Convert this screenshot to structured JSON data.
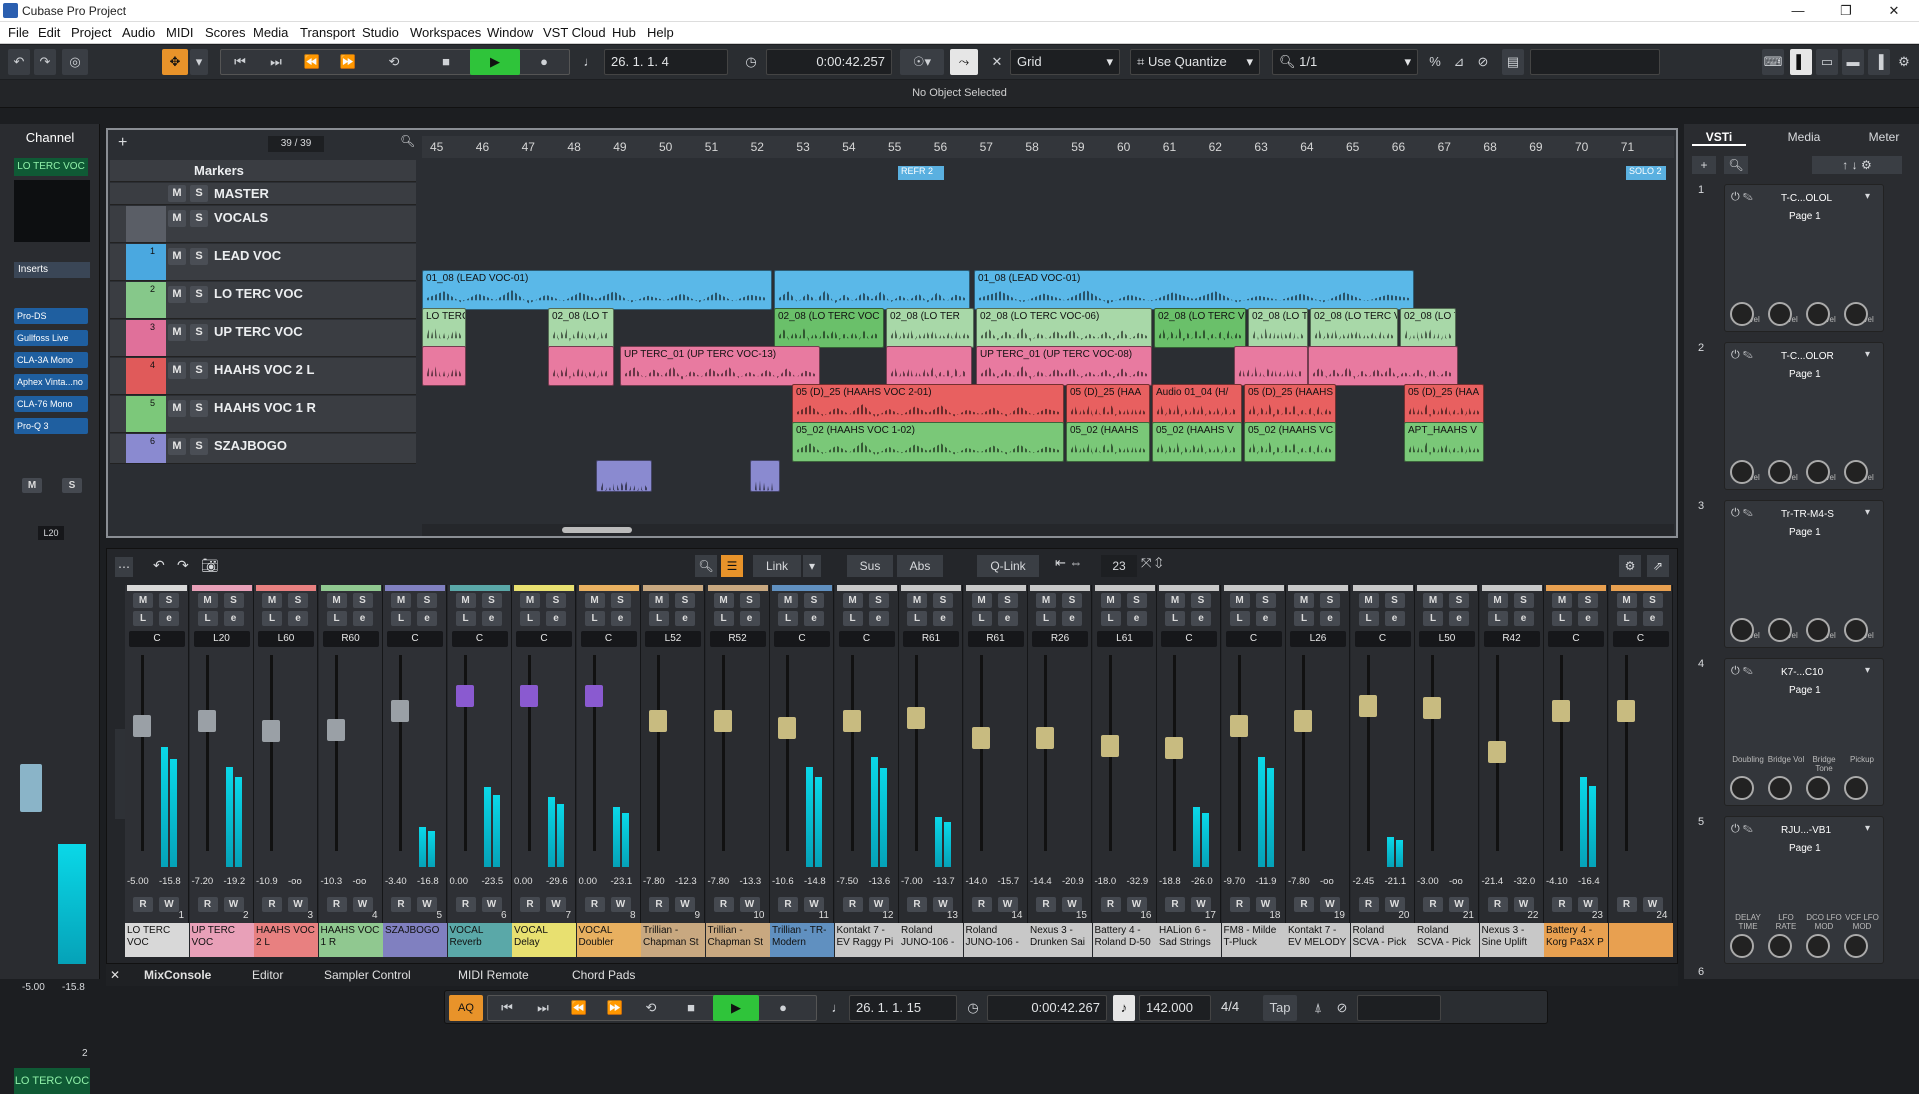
{
  "window": {
    "title": "Cubase Pro Project",
    "min": "—",
    "max": "❐",
    "close": "✕"
  },
  "menu": [
    "File",
    "Edit",
    "Project",
    "Audio",
    "MIDI",
    "Scores",
    "Media",
    "Transport",
    "Studio",
    "Workspaces",
    "Window",
    "VST Cloud",
    "Hub",
    "Help"
  ],
  "toolbar": {
    "position": "26. 1. 1.  4",
    "time": "0:00:42.257",
    "grid": "Grid",
    "quantize": "Use Quantize",
    "quant_value": "1/1"
  },
  "infoline": "No Object Selected",
  "left": {
    "title": "Channel",
    "track": "LO TERC VOC",
    "inserts_label": "Inserts",
    "inserts": [
      "Pro-DS",
      "Gullfoss Live",
      "CLA-3A Mono",
      "Aphex Vinta...no",
      "CLA-76 Mono",
      "Pro-Q 3"
    ],
    "pan": "L20",
    "vol_a": "-5.00",
    "vol_b": "-15.8",
    "bottom_name": "LO TERC VOC",
    "num": "2"
  },
  "project": {
    "count": "39 / 39",
    "bars": [
      "45",
      "46",
      "47",
      "48",
      "49",
      "50",
      "51",
      "52",
      "53",
      "54",
      "55",
      "56",
      "57",
      "58",
      "59",
      "60",
      "61",
      "62",
      "63",
      "64",
      "65",
      "66",
      "67",
      "68",
      "69",
      "70",
      "71"
    ],
    "markers_label": "Markers",
    "master_label": "MASTER",
    "marker_refr": "REFR 2",
    "marker_solo": "SOLO 2",
    "tracks": [
      {
        "name": "VOCALS",
        "num": ""
      },
      {
        "name": "LEAD VOC",
        "num": "1"
      },
      {
        "name": "LO TERC VOC",
        "num": "2"
      },
      {
        "name": "UP TERC VOC",
        "num": "3"
      },
      {
        "name": "HAAHS VOC 2 L",
        "num": "4"
      },
      {
        "name": "HAAHS VOC 1 R",
        "num": "5"
      },
      {
        "name": "SZAJBOGO",
        "num": "6"
      }
    ],
    "clips": {
      "lead1": "01_08 (LEAD VOC-01)",
      "lead2": "01_08 (LEAD VOC-01)",
      "lo1": "LO TERC",
      "lo2": "02_08 (LO T",
      "lo3": "02_08 (LO TERC VOC",
      "lo4": "02_08 (LO TER",
      "lo5": "02_08 (LO TERC VOC-06)",
      "lo6": "02_08 (LO TERC V",
      "lo7": "02_08 (LO TER",
      "lo8": "02_08 (LO TERC VC",
      "lo9": "02_08 (LO TERC",
      "up1": "UP TERC_01 (UP TERC VOC-13)",
      "up2": "UP TERC_01 (UP TERC VOC-08)",
      "h2a": "05 (D)_25 (HAAHS VOC 2-01)",
      "h2b": "05 (D)_25 (HAA",
      "h2c": "Audio 01_04 (H/",
      "h2d": "05 (D)_25 (HAAHS",
      "h2e": "05 (D)_25 (HAA",
      "h1a": "05_02 (HAAHS VOC 1-02)",
      "h1b": "05_02 (HAAHS",
      "h1c": "05_02 (HAAHS V",
      "h1d": "05_02 (HAAHS VC",
      "h1e": "APT_HAAHS V"
    }
  },
  "mixer": {
    "link": "Link",
    "sus": "Sus",
    "abs": "Abs",
    "qlink": "Q-Link",
    "count": "23",
    "channels": [
      {
        "n": "1",
        "pan": "C",
        "va": "-5.00",
        "vb": "-15.8",
        "name": "LO TERC VOC",
        "color": "#d8d8d8",
        "h": 120,
        "fy": 60,
        "fc": "#9aa0a6"
      },
      {
        "n": "2",
        "pan": "L20",
        "va": "-7.20",
        "vb": "-19.2",
        "name": "UP TERC VOC",
        "color": "#e8a0b8",
        "h": 100,
        "fy": 55,
        "fc": "#9aa0a6"
      },
      {
        "n": "3",
        "pan": "L60",
        "va": "-10.9",
        "vb": "-oo",
        "name": "HAAHS VOC 2 L",
        "color": "#e88080",
        "h": 0,
        "fy": 65,
        "fc": "#9aa0a6"
      },
      {
        "n": "4",
        "pan": "R60",
        "va": "-10.3",
        "vb": "-oo",
        "name": "HAAHS VOC 1 R",
        "color": "#90c890",
        "h": 0,
        "fy": 64,
        "fc": "#9aa0a6"
      },
      {
        "n": "5",
        "pan": "C",
        "va": "-3.40",
        "vb": "-16.8",
        "name": "SZAJBOGO",
        "color": "#8080c0",
        "h": 40,
        "fy": 45,
        "fc": "#9aa0a6"
      },
      {
        "n": "6",
        "pan": "C",
        "va": "0.00",
        "vb": "-23.5",
        "name": "VOCAL Reverb",
        "color": "#5aa8a8",
        "h": 80,
        "fy": 30,
        "fc": "#8a5ad0"
      },
      {
        "n": "7",
        "pan": "C",
        "va": "0.00",
        "vb": "-29.6",
        "name": "VOCAL Delay",
        "color": "#e8e070",
        "h": 70,
        "fy": 30,
        "fc": "#8a5ad0"
      },
      {
        "n": "8",
        "pan": "C",
        "va": "0.00",
        "vb": "-23.1",
        "name": "VOCAL Doubler",
        "color": "#e8b060",
        "h": 60,
        "fy": 30,
        "fc": "#8a5ad0"
      },
      {
        "n": "9",
        "pan": "L52",
        "va": "-7.80",
        "vb": "-12.3",
        "name": "Trillian - Chapman St",
        "color": "#c8a880",
        "h": 0,
        "fy": 55,
        "fc": "#c8bb80"
      },
      {
        "n": "10",
        "pan": "R52",
        "va": "-7.80",
        "vb": "-13.3",
        "name": "Trillian - Chapman St",
        "color": "#c8a880",
        "h": 0,
        "fy": 55,
        "fc": "#c8bb80"
      },
      {
        "n": "11",
        "pan": "C",
        "va": "-10.6",
        "vb": "-14.8",
        "name": "Trillian - TR-Modern",
        "color": "#6090c0",
        "h": 100,
        "fy": 62,
        "fc": "#c8bb80"
      },
      {
        "n": "12",
        "pan": "C",
        "va": "-7.50",
        "vb": "-13.6",
        "name": "Kontakt 7 - EV Raggy Pi",
        "color": "#c8c8c8",
        "h": 110,
        "fy": 55,
        "fc": "#c8bb80"
      },
      {
        "n": "13",
        "pan": "R61",
        "va": "-7.00",
        "vb": "-13.7",
        "name": "Roland JUNO-106 -",
        "color": "#c8c8c8",
        "h": 50,
        "fy": 52,
        "fc": "#c8bb80"
      },
      {
        "n": "14",
        "pan": "R61",
        "va": "-14.0",
        "vb": "-15.7",
        "name": "Roland JUNO-106 -",
        "color": "#c8c8c8",
        "h": 0,
        "fy": 72,
        "fc": "#c8bb80"
      },
      {
        "n": "15",
        "pan": "R26",
        "va": "-14.4",
        "vb": "-20.9",
        "name": "Nexus 3 - Drunken Sai",
        "color": "#c8c8c8",
        "h": 0,
        "fy": 72,
        "fc": "#c8bb80"
      },
      {
        "n": "16",
        "pan": "L61",
        "va": "-18.0",
        "vb": "-32.9",
        "name": "Battery 4 - Roland D-50",
        "color": "#c8c8c8",
        "h": 0,
        "fy": 80,
        "fc": "#c8bb80"
      },
      {
        "n": "17",
        "pan": "C",
        "va": "-18.8",
        "vb": "-26.0",
        "name": "HALion 6 - Sad Strings",
        "color": "#c8c8c8",
        "h": 60,
        "fy": 82,
        "fc": "#c8bb80"
      },
      {
        "n": "18",
        "pan": "C",
        "va": "-9.70",
        "vb": "-11.9",
        "name": "FM8 - Milde T-Pluck",
        "color": "#c8c8c8",
        "h": 110,
        "fy": 60,
        "fc": "#c8bb80"
      },
      {
        "n": "19",
        "pan": "L26",
        "va": "-7.80",
        "vb": "-oo",
        "name": "Kontakt 7 - EV MELODY",
        "color": "#c8c8c8",
        "h": 0,
        "fy": 55,
        "fc": "#c8bb80"
      },
      {
        "n": "20",
        "pan": "C",
        "va": "-2.45",
        "vb": "-21.1",
        "name": "Roland SCVA - Pick",
        "color": "#c8c8c8",
        "h": 30,
        "fy": 40,
        "fc": "#c8bb80"
      },
      {
        "n": "21",
        "pan": "L50",
        "va": "-3.00",
        "vb": "-oo",
        "name": "Roland SCVA - Pick",
        "color": "#c8c8c8",
        "h": 0,
        "fy": 42,
        "fc": "#c8bb80"
      },
      {
        "n": "22",
        "pan": "R42",
        "va": "-21.4",
        "vb": "-32.0",
        "name": "Nexus 3 - Sine Uplift",
        "color": "#c8c8c8",
        "h": 0,
        "fy": 86,
        "fc": "#c8bb80"
      },
      {
        "n": "23",
        "pan": "C",
        "va": "-4.10",
        "vb": "-16.4",
        "name": "Battery 4 - Korg Pa3X P",
        "color": "#e8a050",
        "h": 90,
        "fy": 45,
        "fc": "#c8bb80"
      },
      {
        "n": "24",
        "pan": "C",
        "va": "",
        "vb": "",
        "name": "",
        "color": "#e8a050",
        "h": 0,
        "fy": 45,
        "fc": "#c8bb80"
      }
    ]
  },
  "tabs": [
    "MixConsole",
    "Editor",
    "Sampler Control",
    "MIDI Remote",
    "Chord Pads"
  ],
  "transport": {
    "aq": "AQ",
    "position": "26. 1. 1. 15",
    "time": "0:00:42.267",
    "tempo": "142.000",
    "sig": "4/4",
    "tap": "Tap"
  },
  "right": {
    "tabs": [
      "VSTi",
      "Media",
      "Meter"
    ],
    "instruments": [
      {
        "n": "1",
        "name": "T-C...OLOL",
        "page": "Page 1",
        "labels": [
          "1Level",
          "2Level",
          "3Level",
          "4Level"
        ]
      },
      {
        "n": "2",
        "name": "T-C...OLOR",
        "page": "Page 1",
        "labels": [
          "1Level",
          "2Level",
          "3Level",
          "4Level"
        ]
      },
      {
        "n": "3",
        "name": "Tr-TR-M4-S",
        "page": "Page 1",
        "labels": [
          "1Level",
          "2Level",
          "3Level",
          "4Level"
        ]
      },
      {
        "n": "4",
        "name": "K7-...C10",
        "page": "Page 1",
        "labels": [
          "Doubling",
          "Bridge Vol",
          "Bridge Tone",
          "Pickup"
        ]
      },
      {
        "n": "5",
        "name": "RJU...-VB1",
        "page": "Page 1",
        "labels": [
          "DELAY TIME",
          "LFO RATE",
          "DCO LFO MOD",
          "VCF LFO MOD"
        ]
      }
    ],
    "last": "6"
  }
}
